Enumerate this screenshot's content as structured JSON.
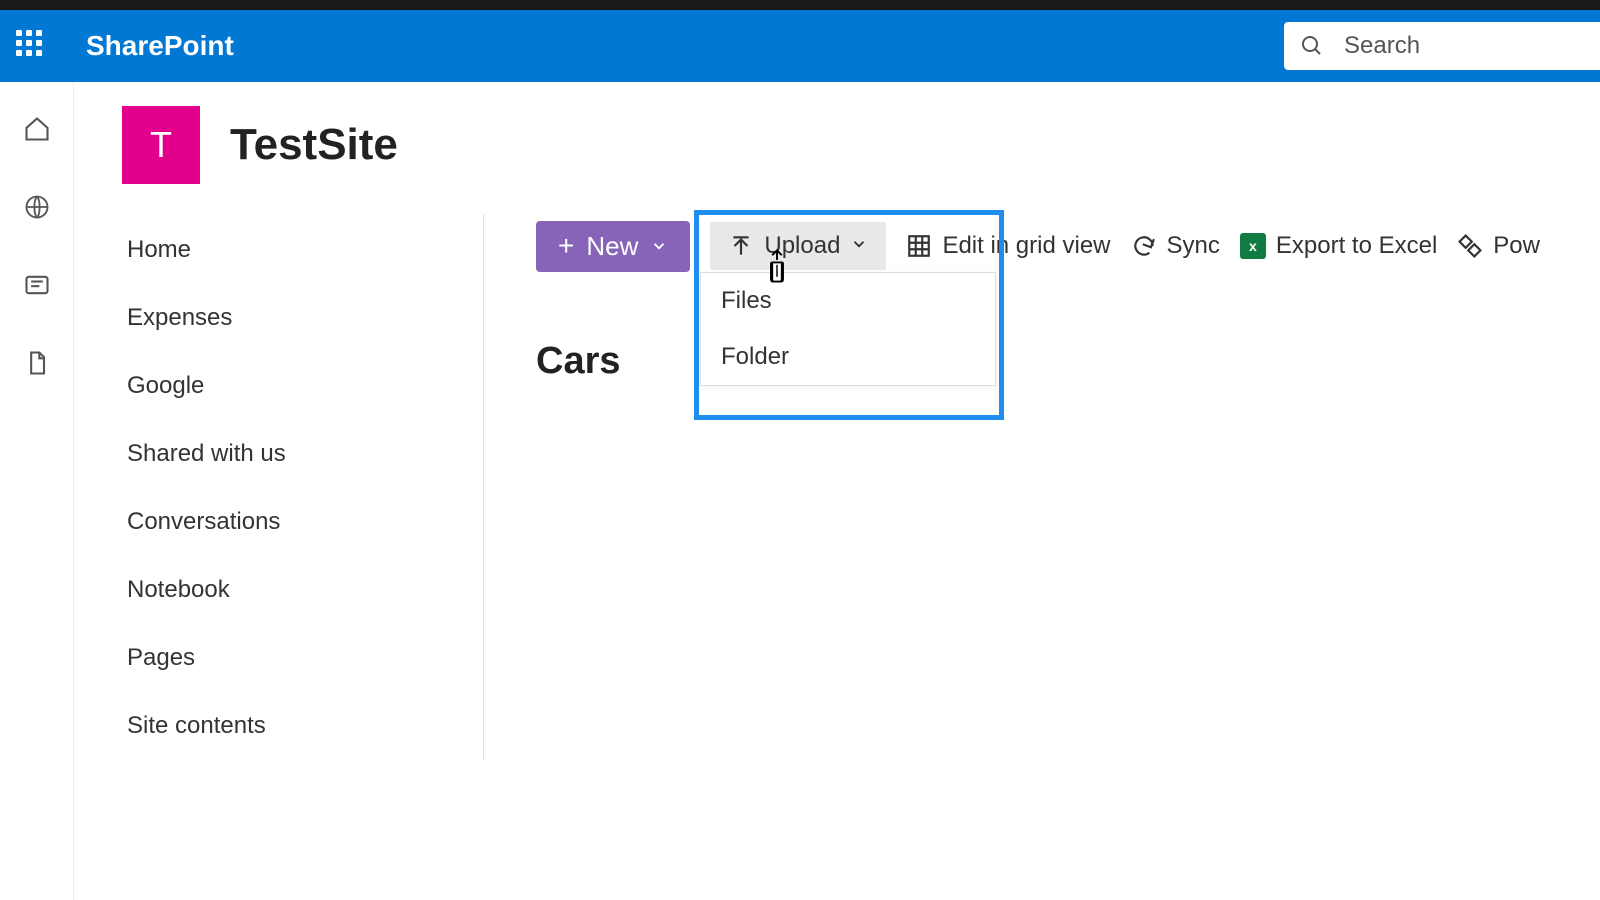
{
  "header": {
    "product": "SharePoint",
    "search_placeholder": "Search"
  },
  "site": {
    "logo_letter": "T",
    "title": "TestSite"
  },
  "nav": {
    "items": [
      {
        "label": "Home"
      },
      {
        "label": "Expenses"
      },
      {
        "label": "Google"
      },
      {
        "label": "Shared with us"
      },
      {
        "label": "Conversations"
      },
      {
        "label": "Notebook"
      },
      {
        "label": "Pages"
      },
      {
        "label": "Site contents"
      }
    ]
  },
  "commands": {
    "new": "New",
    "upload": "Upload",
    "edit_grid": "Edit in grid view",
    "sync": "Sync",
    "export_excel": "Export to Excel",
    "power": "Pow"
  },
  "upload_menu": {
    "files": "Files",
    "folder": "Folder"
  },
  "list": {
    "title": "Cars"
  },
  "excel_icon_text": "x"
}
